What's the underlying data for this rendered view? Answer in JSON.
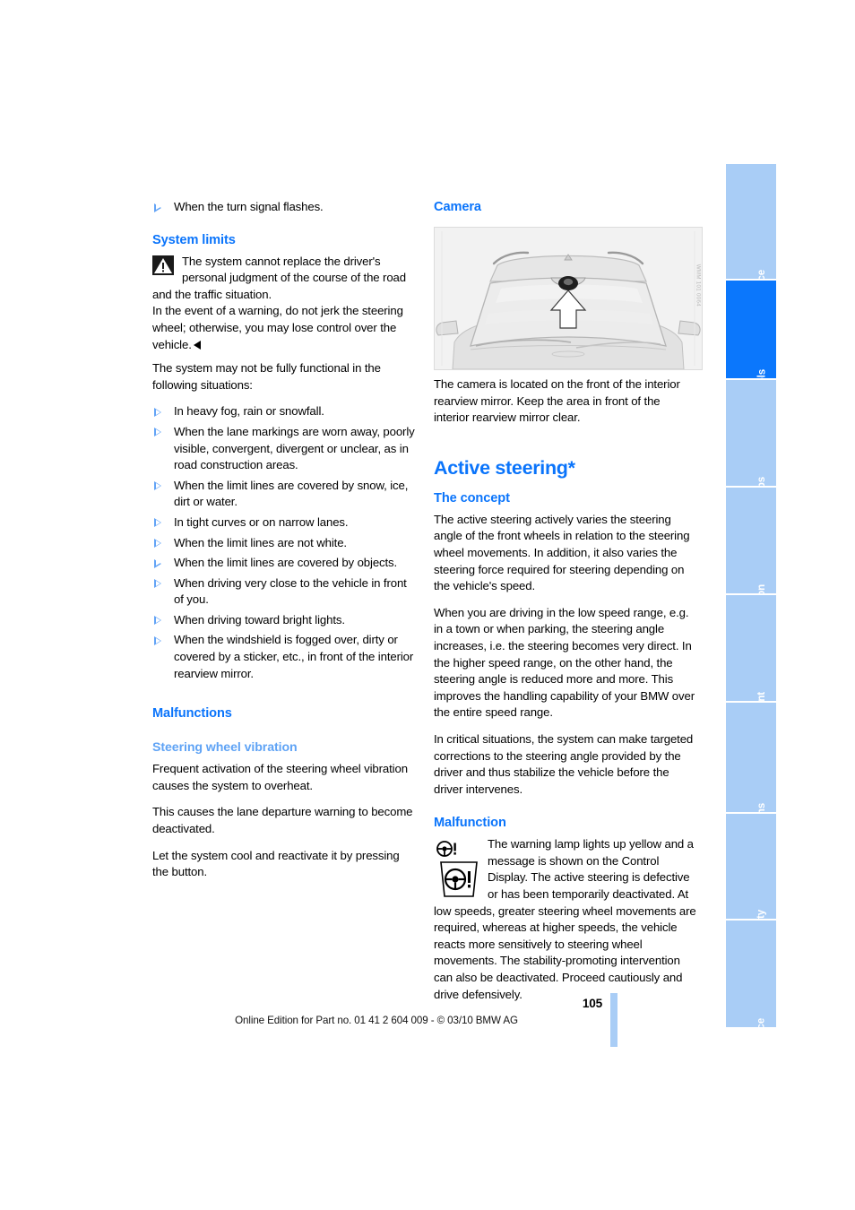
{
  "document": {
    "page_number": "105",
    "footer_note": "Online Edition for Part no. 01 41 2 604 009 - © 03/10 BMW AG"
  },
  "left_column": {
    "lead_bullet": "When the turn signal flashes.",
    "system_limits": {
      "heading": "System limits",
      "warning_text": "The system cannot replace the driver's personal judgment of the course of the road and the traffic situation.",
      "warning_text_2": "In the event of a warning, do not jerk the steering wheel; otherwise, you may lose control over the vehicle.",
      "intro": "The system may not be fully functional in the following situations:",
      "bullets": [
        "In heavy fog, rain or snowfall.",
        "When the lane markings are worn away, poorly visible, convergent, divergent or unclear, as in road construction areas.",
        "When the limit lines are covered by snow, ice, dirt or water.",
        "In tight curves or on narrow lanes.",
        "When the limit lines are not white.",
        "When the limit lines are covered by objects.",
        "When driving very close to the vehicle in front of you.",
        "When driving toward bright lights.",
        "When the windshield is fogged over, dirty or covered by a sticker, etc., in front of the interior rearview mirror."
      ]
    },
    "malfunctions": {
      "heading": "Malfunctions",
      "subheading": "Steering wheel vibration",
      "paragraphs": [
        "Frequent activation of the steering wheel vibration causes the system to overheat.",
        "This causes the lane departure warning to become deactivated.",
        "Let the system cool and reactivate it by pressing the button."
      ]
    }
  },
  "right_column": {
    "camera": {
      "heading": "Camera",
      "figure_id": "WMM 101 0064",
      "caption": "The camera is located on the front of the interior rearview mirror. Keep the area in front of the interior rearview mirror clear."
    },
    "active_steering": {
      "title": "Active steering*",
      "concept_heading": "The concept",
      "concept_paragraphs": [
        "The active steering actively varies the steering angle of the front wheels in relation to the steering wheel movements. In addition, it also varies the steering force required for steering depending on the vehicle's speed.",
        "When you are driving in the low speed range, e.g. in a town or when parking, the steering angle increases, i.e. the steering becomes very direct. In the higher speed range, on the other hand, the steering angle is reduced more and more. This improves the handling capability of your BMW over the entire speed range.",
        "In critical situations, the system can make targeted corrections to the steering angle provided by the driver and thus stabilize the vehicle before the driver intervenes."
      ],
      "malfunction_heading": "Malfunction",
      "malfunction_text": "The warning lamp lights up yellow and a message is shown on the Control Display. The active steering is defective or has been temporarily deactivated. At low speeds, greater steering wheel movements are required, whereas at higher speeds, the vehicle reacts more sensitively to steering wheel movements. The stability-promoting intervention can also be deactivated. Proceed cautiously and drive defensively."
    }
  },
  "tabs": {
    "items": [
      {
        "label": "At a glance",
        "active": false
      },
      {
        "label": "Controls",
        "active": true
      },
      {
        "label": "Driving tips",
        "active": false
      },
      {
        "label": "Navigation",
        "active": false
      },
      {
        "label": "Entertainment",
        "active": false
      },
      {
        "label": "Communications",
        "active": false
      },
      {
        "label": "Mobility",
        "active": false
      },
      {
        "label": "Reference",
        "active": false
      }
    ]
  },
  "colors": {
    "accent_blue": "#0a74fb",
    "light_blue": "#5fa3f5",
    "tab_active": "#0b77fc",
    "tab_inactive": "#a9cdf6"
  }
}
